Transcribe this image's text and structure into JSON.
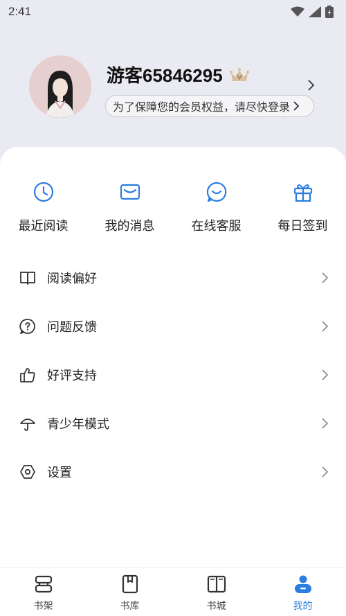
{
  "status_bar": {
    "time": "2:41"
  },
  "profile": {
    "username": "游客65846295",
    "login_hint": "为了保障您的会员权益，请尽快登录"
  },
  "quick_actions": [
    {
      "label": "最近阅读",
      "icon": "clock-icon"
    },
    {
      "label": "我的消息",
      "icon": "mail-icon"
    },
    {
      "label": "在线客服",
      "icon": "chat-smile-icon"
    },
    {
      "label": "每日签到",
      "icon": "gift-icon"
    }
  ],
  "menu": [
    {
      "label": "阅读偏好",
      "icon": "book-open-icon"
    },
    {
      "label": "问题反馈",
      "icon": "question-bubble-icon"
    },
    {
      "label": "好评支持",
      "icon": "thumbs-up-icon"
    },
    {
      "label": "青少年模式",
      "icon": "umbrella-icon"
    },
    {
      "label": "设置",
      "icon": "settings-hexagon-icon"
    }
  ],
  "bottom_nav": [
    {
      "label": "书架",
      "icon": "bookshelf-icon",
      "active": false
    },
    {
      "label": "书库",
      "icon": "book-library-icon",
      "active": false
    },
    {
      "label": "书城",
      "icon": "book-store-icon",
      "active": false
    },
    {
      "label": "我的",
      "icon": "profile-icon",
      "active": true
    }
  ],
  "colors": {
    "accent": "#2a7de1",
    "header_bg": "#e9eaf2",
    "crown": "#c7a27a"
  }
}
